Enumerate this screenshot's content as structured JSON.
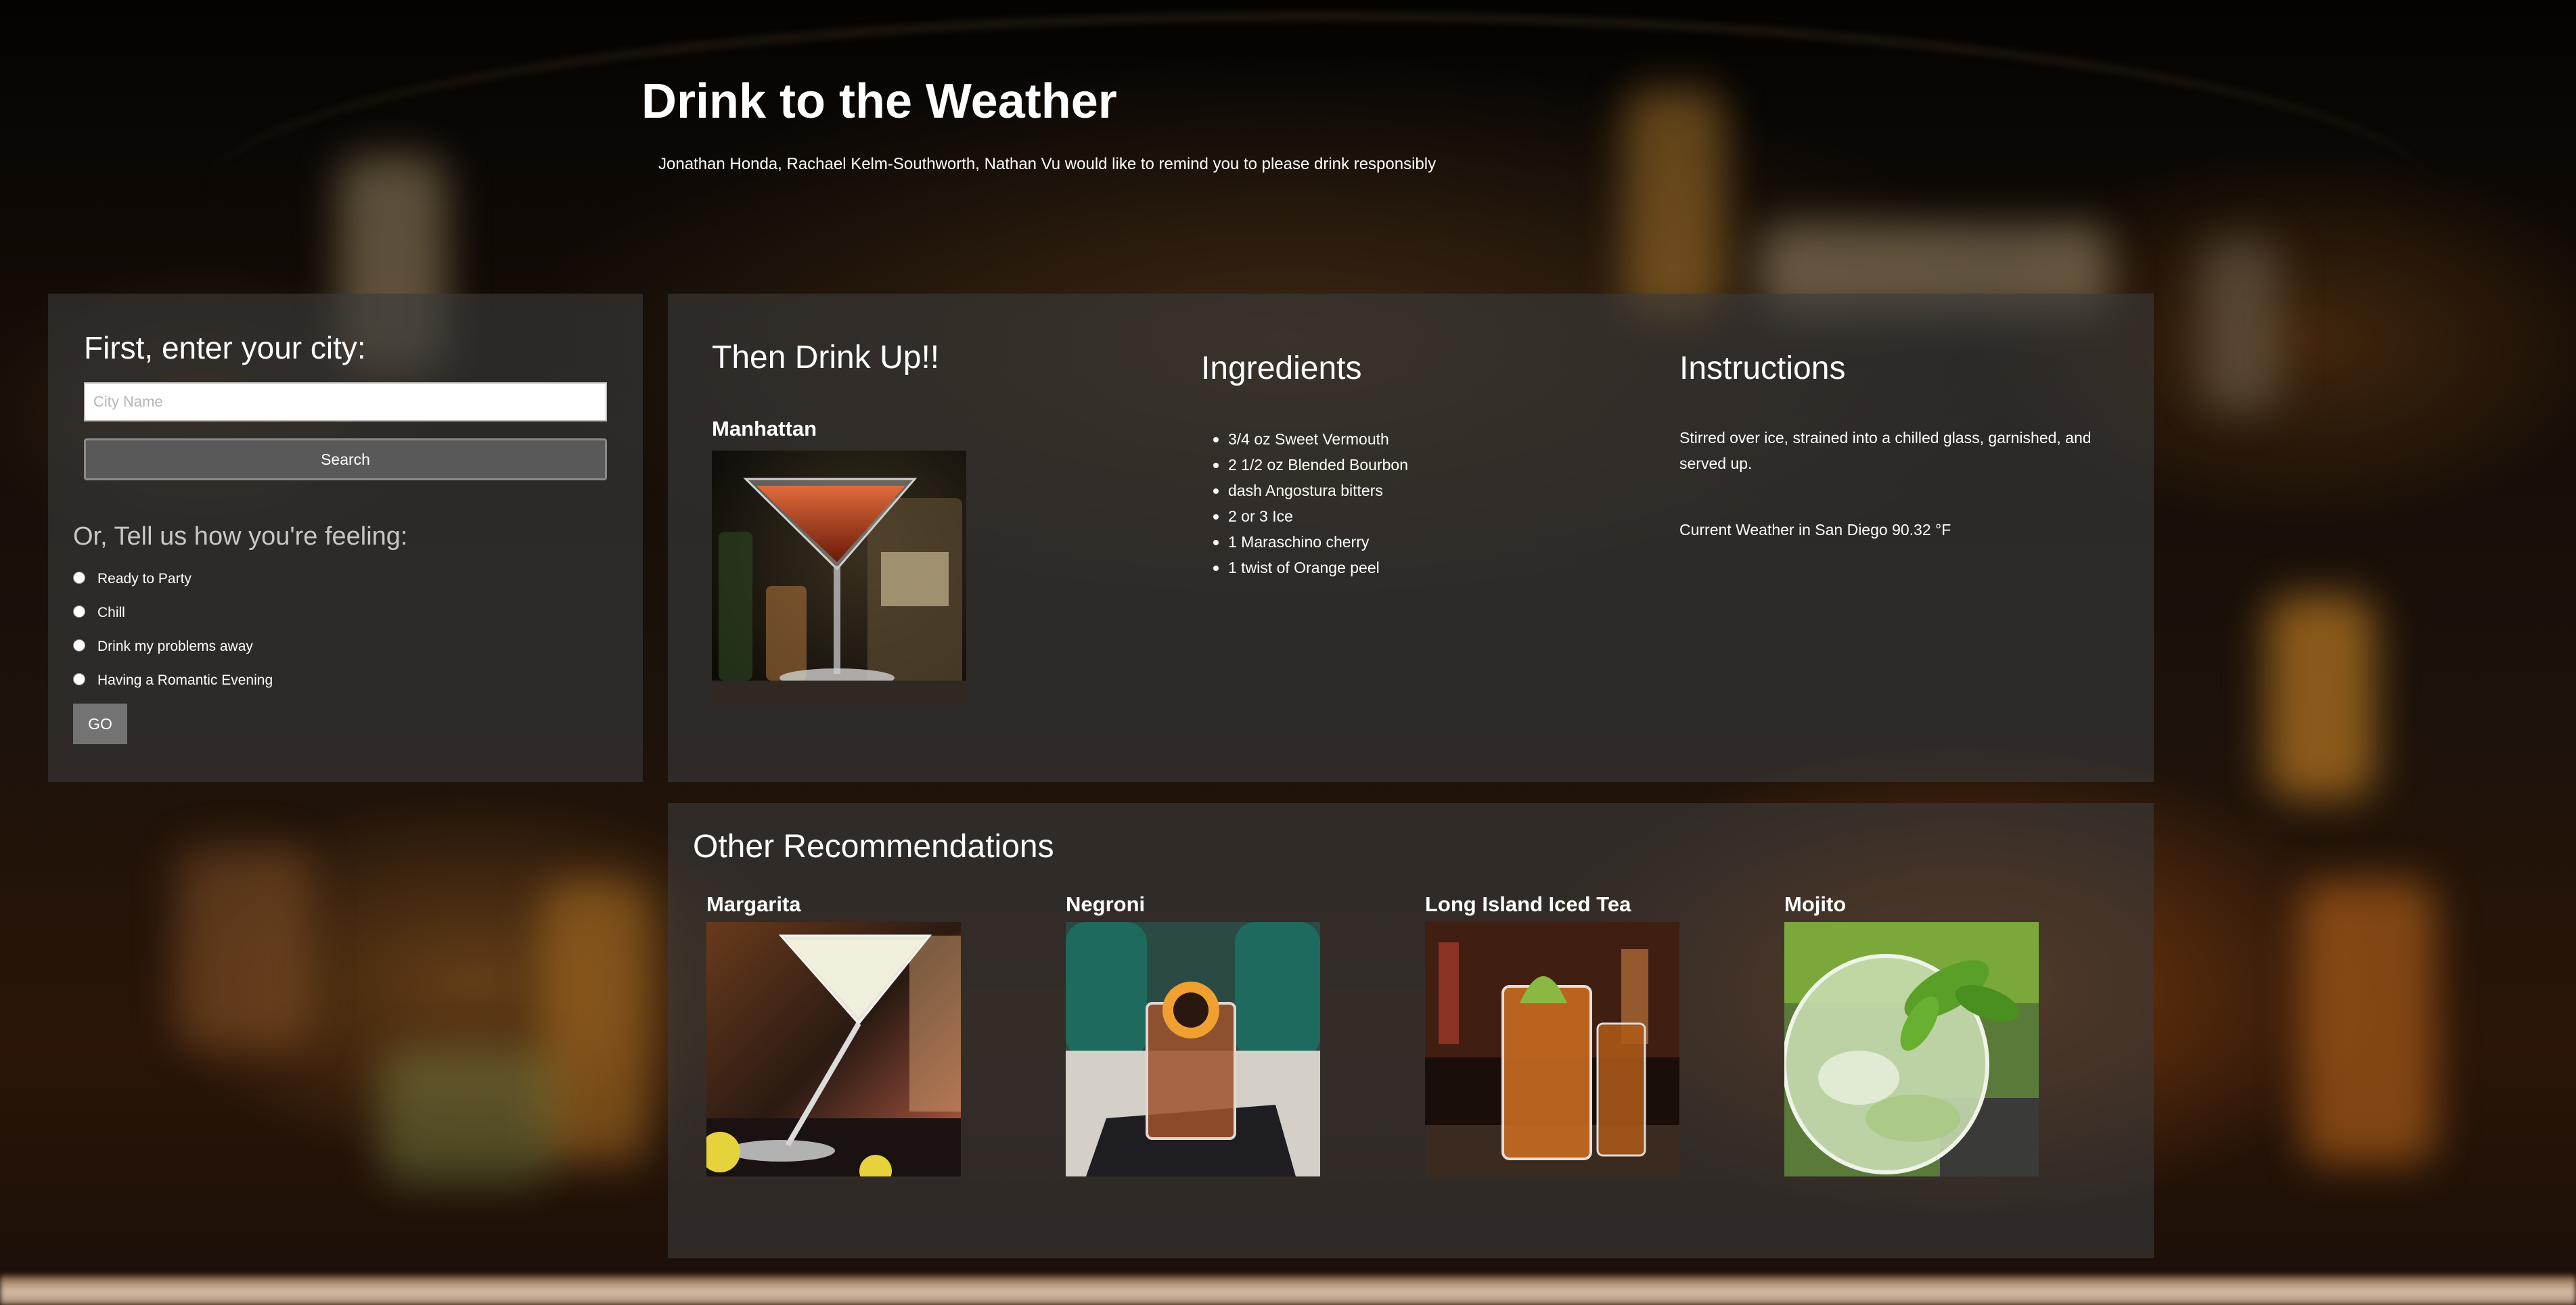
{
  "header": {
    "title": "Drink to the Weather",
    "subtitle": "Jonathan Honda, Rachael Kelm-Southworth, Nathan Vu would like to remind you to please drink responsibly"
  },
  "city_panel": {
    "heading": "First, enter your city:",
    "input_placeholder": "City Name",
    "input_value": "",
    "search_label": "Search"
  },
  "mood_panel": {
    "heading": "Or, Tell us how you're feeling:",
    "options": [
      {
        "label": "Ready to Party",
        "selected": false
      },
      {
        "label": "Chill",
        "selected": false
      },
      {
        "label": "Drink my problems away",
        "selected": false
      },
      {
        "label": "Having a Romantic Evening",
        "selected": false
      }
    ],
    "go_label": "GO"
  },
  "drink": {
    "heading": "Then Drink Up!!",
    "name": "Manhattan",
    "image_icon": "manhattan-cocktail-photo",
    "ingredients_heading": "Ingredients",
    "ingredients": [
      "3/4 oz Sweet Vermouth",
      "2 1/2 oz Blended Bourbon",
      "dash Angostura bitters",
      "2 or 3 Ice",
      "1 Maraschino cherry",
      "1 twist of Orange peel"
    ],
    "instructions_heading": "Instructions",
    "instructions": "Stirred over ice, strained into a chilled glass, garnished, and served up.",
    "weather": "Current Weather in San Diego 90.32 °F"
  },
  "recommendations": {
    "heading": "Other Recommendations",
    "items": [
      {
        "name": "Margarita",
        "image_icon": "margarita-photo"
      },
      {
        "name": "Negroni",
        "image_icon": "negroni-photo"
      },
      {
        "name": "Long Island Iced Tea",
        "image_icon": "long-island-iced-tea-photo"
      },
      {
        "name": "Mojito",
        "image_icon": "mojito-photo"
      }
    ]
  },
  "colors": {
    "panel_bg": "#3a3a3a",
    "search_button_bg": "#595959",
    "go_button_bg": "#737373",
    "feeling_heading": "#c7c7c7"
  }
}
